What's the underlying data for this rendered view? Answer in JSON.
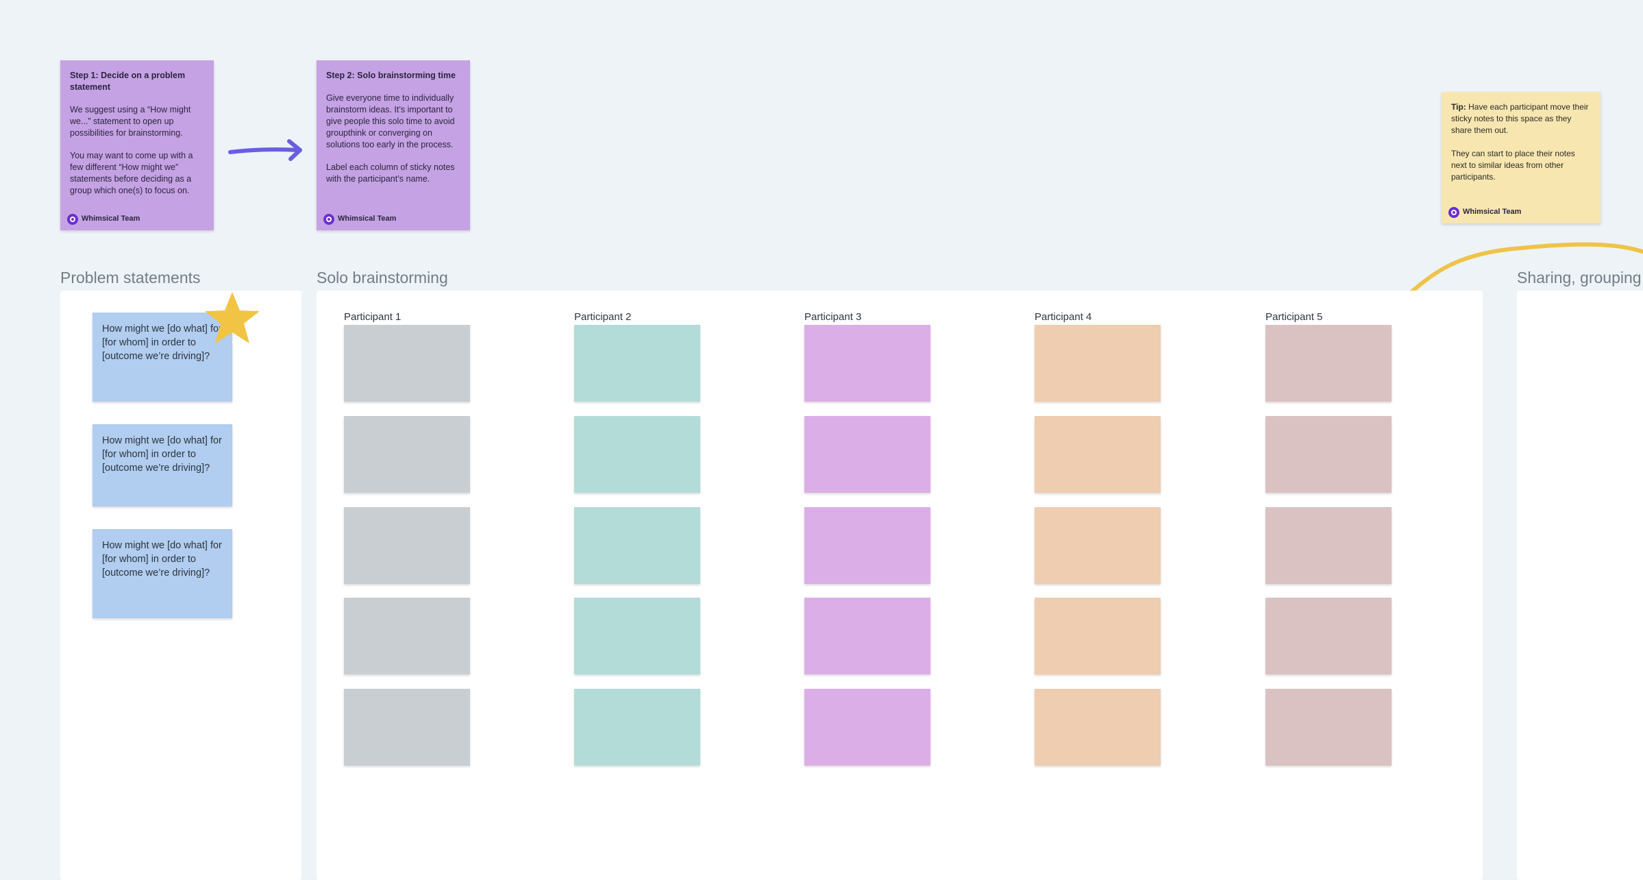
{
  "step1": {
    "title": "Step 1: Decide on a problem statement",
    "para1": "We suggest using a “How might we...” statement to open up possibilities for brainstorming.",
    "para2": "You may want to come up with a few different “How might we” statements before deciding as a group which one(s) to focus on.",
    "author": "Whimsical Team"
  },
  "step2": {
    "title": "Step 2: Solo brainstorming time",
    "para1": "Give everyone time to individually brainstorm ideas. It’s important to give people this solo time to avoid groupthink or converging on solutions too early in the process.",
    "para2": "Label each column of sticky notes with the participant’s name.",
    "author": "Whimsical Team"
  },
  "tip": {
    "label": "Tip:",
    "para1": " Have each participant move their sticky notes to this space as they share them out.",
    "para2": "They can start to place their notes next to similar ideas from other participants.",
    "author": "Whimsical Team"
  },
  "sections": {
    "problem": "Problem statements",
    "solo": "Solo brainstorming",
    "sharing": "Sharing, grouping"
  },
  "problem_notes": [
    "How might we [do what] for [for whom] in order to [outcome we’re driving]?",
    "How might we [do what] for [for whom] in order to [outcome we’re driving]?",
    "How might we [do what] for [for whom] in order to [outcome we’re driving]?"
  ],
  "participants": [
    {
      "name": "Participant 1",
      "color": "#c9ced2"
    },
    {
      "name": "Participant 2",
      "color": "#b3dcd8"
    },
    {
      "name": "Participant 3",
      "color": "#dcaee7"
    },
    {
      "name": "Participant 4",
      "color": "#eecdb0"
    },
    {
      "name": "Participant 5",
      "color": "#dac1c2"
    }
  ],
  "colors": {
    "background": "#eef3f7",
    "step_card": "#c5a2e3",
    "tip_card": "#f7e6b0",
    "problem_note": "#b1cdef",
    "arrow": "#6a5ee0",
    "star": "#f1c443",
    "connector": "#efc34a"
  },
  "icons": {
    "arrow": "right-arrow-icon",
    "star": "star-icon",
    "author_badge": "whimsical-logo-icon",
    "connector": "curved-line-icon"
  }
}
